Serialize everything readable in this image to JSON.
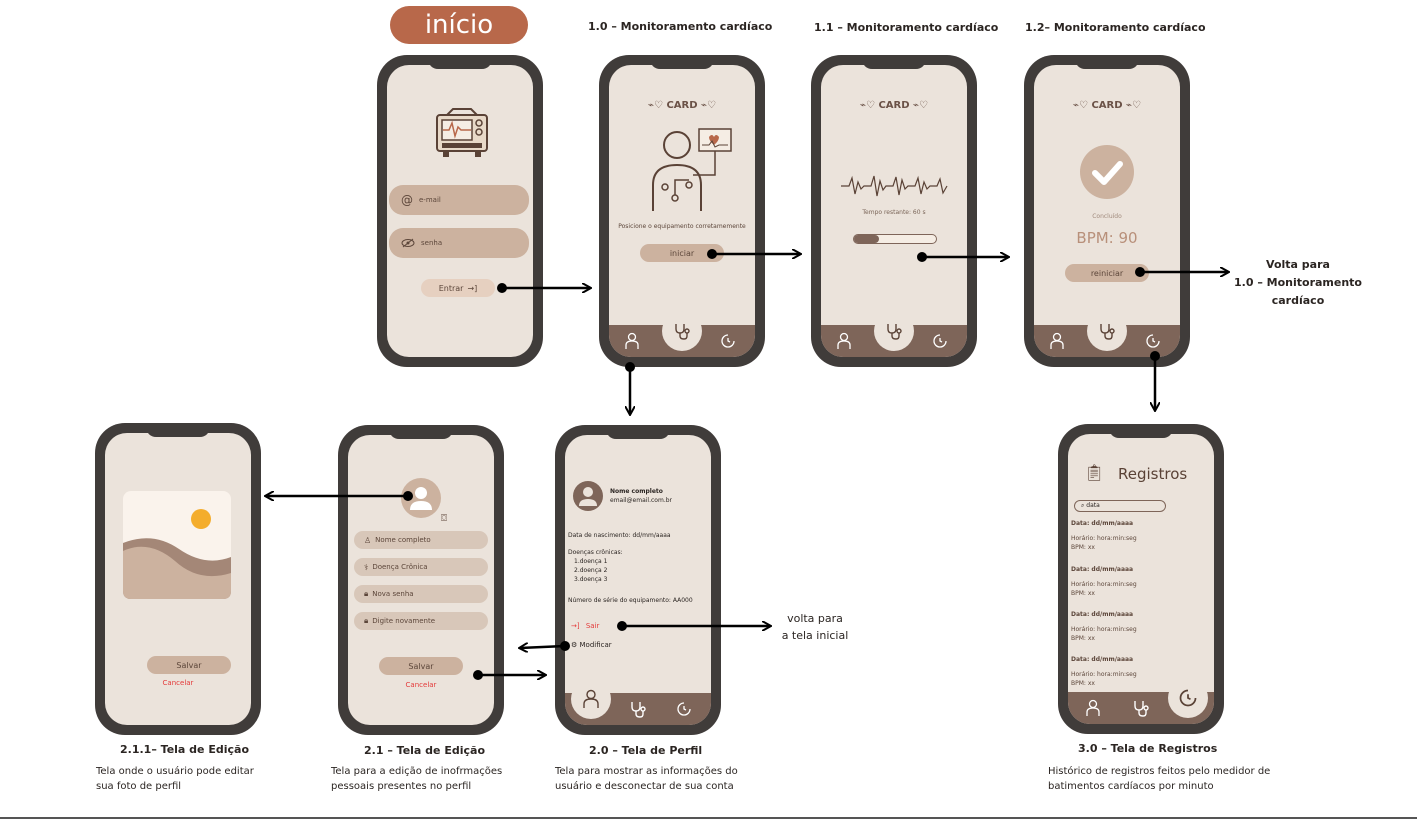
{
  "start_badge": "início",
  "titles": {
    "s10": "1.0 – Monitoramento cardíaco",
    "s11": "1.1 – Monitoramento cardíaco",
    "s12": "1.2– Monitoramento cardíaco"
  },
  "login": {
    "email_placeholder": "e-mail",
    "password_placeholder": "senha",
    "enter_button": "Entrar"
  },
  "card_logo": "CARD",
  "monitor": {
    "instruction": "Posicione o equipamento corretamemente",
    "start_button": "iniciar",
    "remaining": "Tempo restante: 60 s",
    "progress": 0.3,
    "done_label": "Concluído",
    "bpm_text": "BPM: 90",
    "restart_button": "reiniciar"
  },
  "annotations": {
    "back_to_monitor": [
      "Volta para",
      "1.0 – Monitoramento",
      "cardíaco"
    ],
    "back_to_home": [
      "volta para",
      "a tela inicial"
    ]
  },
  "profile": {
    "name": "Nome completo",
    "email": "email@email.com.br",
    "birth": "Data de nascimento: dd/mm/aaaa",
    "chronic_title": "Doenças crônicas:",
    "chronic": [
      "1.doença 1",
      "2.doença 2",
      "3.doença 3"
    ],
    "serial": "Número de série do equipamento: AA000",
    "logout": "Sair",
    "modify": "Modificar"
  },
  "edit": {
    "fields": [
      "Nome completo",
      "Doença Crônica",
      "Nova senha",
      "Digite novamente"
    ],
    "save": "Salvar",
    "cancel": "Cancelar"
  },
  "photo_edit": {
    "save": "Salvar",
    "cancel": "Cancelar"
  },
  "records": {
    "title": "Registros",
    "search_placeholder": "data",
    "entries": [
      {
        "date": "Data: dd/mm/aaaa",
        "time": "Horário: hora:min:seg",
        "bpm": "BPM: xx"
      },
      {
        "date": "Data: dd/mm/aaaa",
        "time": "Horário: hora:min:seg",
        "bpm": "BPM: xx"
      },
      {
        "date": "Data: dd/mm/aaaa",
        "time": "Horário: hora:min:seg",
        "bpm": "BPM: xx"
      },
      {
        "date": "Data: dd/mm/aaaa",
        "time": "Horário: hora:min:seg",
        "bpm": "BPM: xx"
      }
    ]
  },
  "captions": {
    "c211": {
      "title": "2.1.1– Tela de Edição",
      "text": [
        "Tela onde o usuário pode editar",
        "sua foto de perfil"
      ]
    },
    "c21": {
      "title": "2.1 – Tela de Edição",
      "text": [
        "Tela para a edição de inofrmações",
        "pessoais presentes no perfil"
      ]
    },
    "c20": {
      "title": "2.0 – Tela de Perfil",
      "text": [
        "Tela para mostrar as informações do",
        "usuário e desconectar de sua conta"
      ]
    },
    "c30": {
      "title": "3.0 – Tela de Registros",
      "text": [
        "Histórico de registros feitos pelo medidor de",
        "batimentos cardíacos por minuto"
      ]
    }
  }
}
